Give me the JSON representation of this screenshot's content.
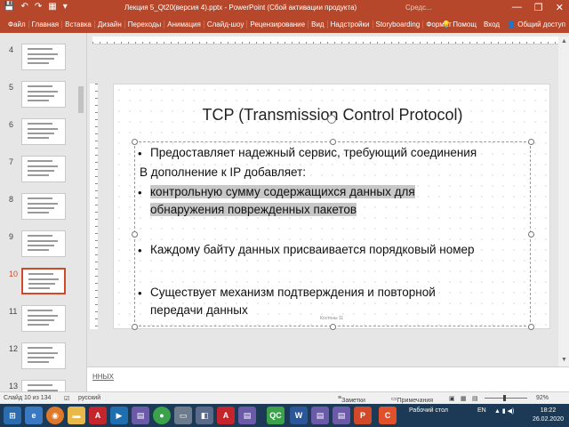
{
  "window": {
    "title": "Лекция 5_Qt20(версия 4).pptx - PowerPoint (Сбой активации продукта)",
    "faded_tab": "Средс...",
    "minimize": "—",
    "restore": "❐",
    "close": "✕"
  },
  "qat": [
    "💾",
    "↶",
    "↷",
    "▦",
    "▾"
  ],
  "ribbon": {
    "tabs": [
      "Файл",
      "Главная",
      "Вставка",
      "Дизайн",
      "Переходы",
      "Анимация",
      "Слайд-шоу",
      "Рецензирование",
      "Вид",
      "Надстройки",
      "Storyboarding",
      "Формат"
    ],
    "help": "Помощ",
    "login": "Вход",
    "share": "Общий доступ"
  },
  "thumbnails": [
    {
      "num": "4"
    },
    {
      "num": "5"
    },
    {
      "num": "6"
    },
    {
      "num": "7"
    },
    {
      "num": "8"
    },
    {
      "num": "9"
    },
    {
      "num": "10",
      "selected": true
    },
    {
      "num": "11"
    },
    {
      "num": "12"
    },
    {
      "num": "13"
    }
  ],
  "slide": {
    "title": "TCP (Transmission Control Protocol)",
    "bullet1": "Предоставляет надежный сервис, требующий соединения",
    "line2": "В дополнение к IP добавляет:",
    "bullet3_line1": " контрольную сумму содержащихся данных для",
    "bullet3_line2": "обнаружения поврежденных пакетов",
    "bullet4": "Каждому байту данных присваивается порядковый номер",
    "bullet5_line1": "Существует механизм подтверждения и повторной",
    "bullet5_line2": "передачи данных",
    "footer": "Костоны 11",
    "bullet_char": "•"
  },
  "notes": {
    "text": "ННЫХ"
  },
  "status": {
    "slide_counter": "Слайд 10 из 134",
    "language": "русский",
    "notes_btn": "Заметки",
    "comments_btn": "Примечания",
    "zoom": "92%"
  },
  "taskbar": {
    "desktop": "Рабочий стол",
    "lang": "EN",
    "time": "18:22",
    "date": "26.02.2020"
  },
  "colors": {
    "accent": "#b7472a",
    "selected": "#d04a2a",
    "taskbar": "#1c3a55"
  }
}
